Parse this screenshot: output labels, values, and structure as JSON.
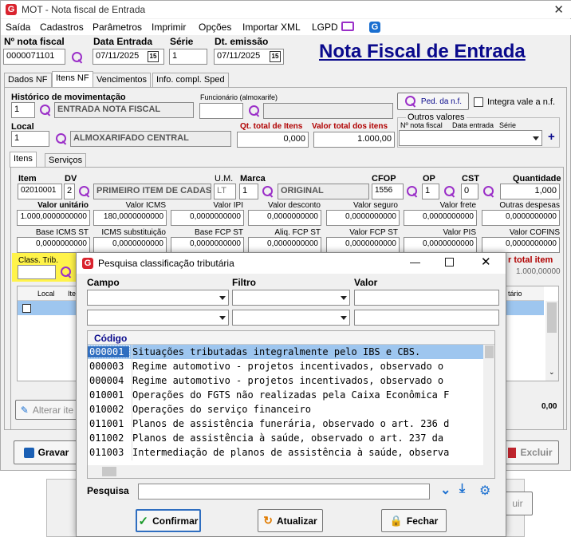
{
  "window": {
    "title": "MOT - Nota fiscal de Entrada"
  },
  "menu": [
    "Saída",
    "Cadastros",
    "Parâmetros",
    "Imprimir",
    "Opções",
    "Importar XML",
    "LGPD"
  ],
  "header": {
    "nf_label": "Nº nota fiscal",
    "nf_value": "0000071101",
    "date_label": "Data Entrada",
    "date_value": "07/11/2025",
    "serie_label": "Série",
    "serie_value": "1",
    "emissao_label": "Dt. emissão",
    "emissao_value": "07/11/2025",
    "big_title": "Nota Fiscal de Entrada"
  },
  "tabs": [
    "Dados NF",
    "Itens NF",
    "Vencimentos",
    "Info. compl. Sped"
  ],
  "hist": {
    "label": "Histórico de movimentação",
    "code": "1",
    "desc": "ENTRADA NOTA FISCAL",
    "func_label": "Funcionário (almoxarife)"
  },
  "ped": {
    "button": "Ped. da n.f.",
    "integra": "Integra vale a n.f.",
    "outros": "Outros valores",
    "col_nf": "Nº nota fiscal",
    "col_data": "Data entrada",
    "col_serie": "Série"
  },
  "local": {
    "label": "Local",
    "code": "1",
    "desc": "ALMOXARIFADO CENTRAL",
    "qt_label": "Qt. total de Itens",
    "qt_value": "0,000",
    "vt_label": "Valor total dos itens",
    "vt_value": "1.000,00"
  },
  "subtabs": [
    "Itens",
    "Serviços"
  ],
  "item": {
    "item_label": "Item",
    "item_value": "02010001",
    "dv_label": "DV",
    "dv_value": "2",
    "desc": "PRIMEIRO ITEM DE CADAS",
    "um_label": "U.M.",
    "um_value": "LT",
    "marca_label": "Marca",
    "marca_code": "1",
    "marca_desc": "ORIGINAL",
    "cfop_label": "CFOP",
    "cfop_value": "1556",
    "op_label": "OP",
    "op_value": "1",
    "cst_label": "CST",
    "cst_value": "0",
    "qtd_label": "Quantidade",
    "qtd_value": "1,000"
  },
  "row1": [
    {
      "l": "Valor unitário",
      "v": "1.000,0000000000"
    },
    {
      "l": "Valor ICMS",
      "v": "180,0000000000"
    },
    {
      "l": "Valor IPI",
      "v": "0,0000000000"
    },
    {
      "l": "Valor desconto",
      "v": "0,0000000000"
    },
    {
      "l": "Valor seguro",
      "v": "0,0000000000"
    },
    {
      "l": "Valor frete",
      "v": "0,0000000000"
    },
    {
      "l": "Outras despesas",
      "v": "0,0000000000"
    }
  ],
  "row2": [
    {
      "l": "Base ICMS ST",
      "v": "0,0000000000"
    },
    {
      "l": "ICMS substituição",
      "v": "0,0000000000"
    },
    {
      "l": "Base FCP ST",
      "v": "0,0000000000"
    },
    {
      "l": "Aliq. FCP ST",
      "v": "0,0000000000"
    },
    {
      "l": "Valor FCP ST",
      "v": "0,0000000000"
    },
    {
      "l": "Valor PIS",
      "v": "0,0000000000"
    },
    {
      "l": "Valor COFINS",
      "v": "0,0000000000"
    }
  ],
  "class_trib": {
    "label": "Class. Trib."
  },
  "bg": {
    "total_label": "r total item",
    "total_value": "1.000,00000",
    "col_local": "Local",
    "col_ite": "Ite",
    "col_tario": "tário",
    "zero": "0,00",
    "alterar": "Alterar ite",
    "gravar": "Gravar",
    "excluir": "Excluir",
    "uir": "uir"
  },
  "dialog": {
    "title": "Pesquisa classificação tributária",
    "campo": "Campo",
    "filtro": "Filtro",
    "valor": "Valor",
    "col_codigo": "Código",
    "rows": [
      {
        "c": "000001",
        "d": "Situações tributadas integralmente pelo IBS e CBS."
      },
      {
        "c": "000003",
        "d": "Regime automotivo - projetos incentivados, observado o"
      },
      {
        "c": "000004",
        "d": "Regime automotivo - projetos incentivados, observado o"
      },
      {
        "c": "010001",
        "d": "Operações do FGTS não realizadas pela Caixa Econômica F"
      },
      {
        "c": "010002",
        "d": "Operações do serviço financeiro"
      },
      {
        "c": "011001",
        "d": "Planos de assistência funerária, observado o art. 236 d"
      },
      {
        "c": "011002",
        "d": "Planos de assistência à saúde, observado o art. 237 da"
      },
      {
        "c": "011003",
        "d": "Intermediação de planos de assistência à saúde, observa"
      }
    ],
    "pesquisa": "Pesquisa",
    "confirmar": "Confirmar",
    "atualizar": "Atualizar",
    "fechar": "Fechar"
  }
}
